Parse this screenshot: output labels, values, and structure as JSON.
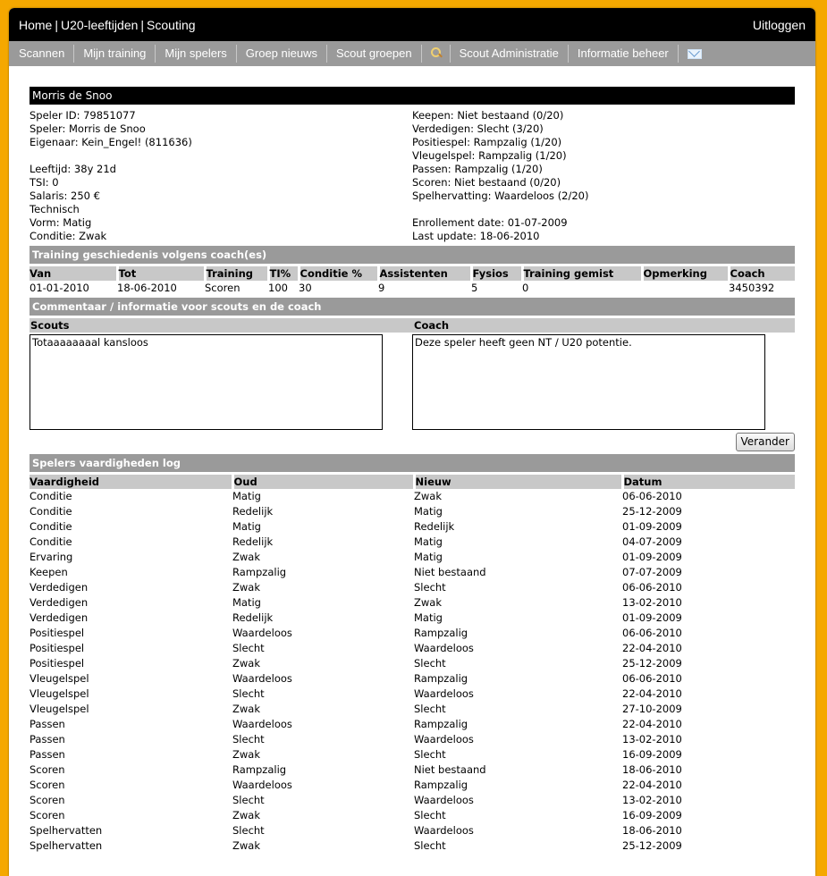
{
  "header": {
    "crumbs": [
      "Home",
      "U20-leeftijden",
      "Scouting"
    ],
    "logout": "Uitloggen"
  },
  "nav": {
    "items": [
      "Scannen",
      "Mijn training",
      "Mijn spelers",
      "Groep nieuws",
      "Scout groepen"
    ],
    "admin": "Scout Administratie",
    "info": "Informatie beheer"
  },
  "player": {
    "name": "Morris de Snoo",
    "left": [
      "Speler ID: 79851077",
      "Speler: Morris de Snoo",
      "Eigenaar: Kein_Engel! (811636)",
      "",
      "Leeftijd: 38y 21d",
      "TSI: 0",
      "Salaris: 250 €",
      "Technisch",
      "Vorm: Matig",
      "Conditie: Zwak"
    ],
    "right": [
      "Keepen: Niet bestaand (0/20)",
      "Verdedigen: Slecht (3/20)",
      "Positiespel: Rampzalig (1/20)",
      "Vleugelspel: Rampzalig (1/20)",
      "Passen: Rampzalig (1/20)",
      "Scoren: Niet bestaand (0/20)",
      "Spelhervatting: Waardeloos (2/20)",
      "",
      "Enrollement date: 01-07-2009",
      "Last update: 18-06-2010"
    ]
  },
  "training": {
    "title": "Training geschiedenis volgens coach(es)",
    "headers": [
      "Van",
      "Tot",
      "Training",
      "TI%",
      "Conditie %",
      "Assistenten",
      "Fysios",
      "Training gemist",
      "Opmerking",
      "Coach"
    ],
    "rows": [
      [
        "01-01-2010",
        "18-06-2010",
        "Scoren",
        "100",
        "30",
        "9",
        "5",
        "0",
        "",
        "3450392"
      ]
    ]
  },
  "comments": {
    "title": "Commentaar / informatie voor scouts en de coach",
    "scouts_label": "Scouts",
    "coach_label": "Coach",
    "scouts_text": "Totaaaaaaaal kansloos",
    "coach_text": "Deze speler heeft geen NT / U20 potentie.",
    "button": "Verander"
  },
  "skills_log": {
    "title": "Spelers vaardigheden log",
    "headers": [
      "Vaardigheid",
      "Oud",
      "Nieuw",
      "Datum"
    ],
    "rows": [
      [
        "Conditie",
        "Matig",
        "Zwak",
        "06-06-2010"
      ],
      [
        "Conditie",
        "Redelijk",
        "Matig",
        "25-12-2009"
      ],
      [
        "Conditie",
        "Matig",
        "Redelijk",
        "01-09-2009"
      ],
      [
        "Conditie",
        "Redelijk",
        "Matig",
        "04-07-2009"
      ],
      [
        "Ervaring",
        "Zwak",
        "Matig",
        "01-09-2009"
      ],
      [
        "Keepen",
        "Rampzalig",
        "Niet bestaand",
        "07-07-2009"
      ],
      [
        "Verdedigen",
        "Zwak",
        "Slecht",
        "06-06-2010"
      ],
      [
        "Verdedigen",
        "Matig",
        "Zwak",
        "13-02-2010"
      ],
      [
        "Verdedigen",
        "Redelijk",
        "Matig",
        "01-09-2009"
      ],
      [
        "Positiespel",
        "Waardeloos",
        "Rampzalig",
        "06-06-2010"
      ],
      [
        "Positiespel",
        "Slecht",
        "Waardeloos",
        "22-04-2010"
      ],
      [
        "Positiespel",
        "Zwak",
        "Slecht",
        "25-12-2009"
      ],
      [
        "Vleugelspel",
        "Waardeloos",
        "Rampzalig",
        "06-06-2010"
      ],
      [
        "Vleugelspel",
        "Slecht",
        "Waardeloos",
        "22-04-2010"
      ],
      [
        "Vleugelspel",
        "Zwak",
        "Slecht",
        "27-10-2009"
      ],
      [
        "Passen",
        "Waardeloos",
        "Rampzalig",
        "22-04-2010"
      ],
      [
        "Passen",
        "Slecht",
        "Waardeloos",
        "13-02-2010"
      ],
      [
        "Passen",
        "Zwak",
        "Slecht",
        "16-09-2009"
      ],
      [
        "Scoren",
        "Rampzalig",
        "Niet bestaand",
        "18-06-2010"
      ],
      [
        "Scoren",
        "Waardeloos",
        "Rampzalig",
        "22-04-2010"
      ],
      [
        "Scoren",
        "Slecht",
        "Waardeloos",
        "13-02-2010"
      ],
      [
        "Scoren",
        "Zwak",
        "Slecht",
        "16-09-2009"
      ],
      [
        "Spelhervatten",
        "Slecht",
        "Waardeloos",
        "18-06-2010"
      ],
      [
        "Spelhervatten",
        "Zwak",
        "Slecht",
        "25-12-2009"
      ]
    ]
  },
  "colors": {
    "background": "#f5a800",
    "bar": "#9a9a9a",
    "header_cell": "#c8c8c8"
  },
  "icons": [
    "search-icon",
    "mail-icon"
  ]
}
